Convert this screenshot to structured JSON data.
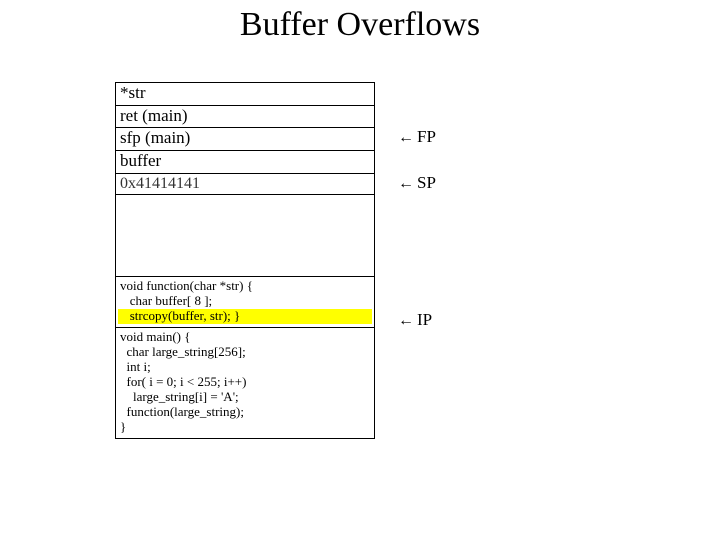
{
  "title": "Buffer Overflows",
  "stack": {
    "rows": [
      {
        "text": "*str"
      },
      {
        "text": "ret (main)"
      },
      {
        "text": "sfp (main)"
      },
      {
        "text": "buffer"
      },
      {
        "text": "0x41414141"
      }
    ]
  },
  "code1": {
    "l1": "void function(char *str) {",
    "l2": "   char buffer[ 8 ];",
    "l3": "   strcopy(buffer, str); }"
  },
  "code2": {
    "l1": "void main() {",
    "l2": "  char large_string[256];",
    "l3": "  int i;",
    "l4": "  for( i = 0; i < 255; i++)",
    "l5": "    large_string[i] = 'A';",
    "l6": "  function(large_string);",
    "l7": "}"
  },
  "pointers": {
    "fp": "FP",
    "sp": "SP",
    "ip": "IP"
  },
  "arrow_glyph": "←"
}
